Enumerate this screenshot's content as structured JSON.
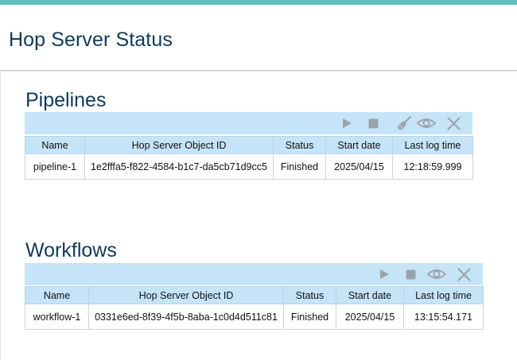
{
  "page": {
    "title": "Hop Server Status"
  },
  "pipelines": {
    "title": "Pipelines",
    "toolbar": [
      "play-icon",
      "stop-icon",
      "clean-icon",
      "eye-icon",
      "close-icon"
    ],
    "columns": [
      "Name",
      "Hop Server Object ID",
      "Status",
      "Start date",
      "Last log time"
    ],
    "rows": [
      [
        "pipeline-1",
        "1e2fffa5-f822-4584-b1c7-da5cb71d9cc5",
        "Finished",
        "2025/04/15",
        "12:18:59.999"
      ]
    ]
  },
  "workflows": {
    "title": "Workflows",
    "toolbar": [
      "play-icon",
      "stop-icon",
      "eye-icon",
      "close-icon"
    ],
    "columns": [
      "Name",
      "Hop Server Object ID",
      "Status",
      "Start date",
      "Last log time"
    ],
    "rows": [
      [
        "workflow-1",
        "0331e6ed-8f39-4f5b-8aba-1c0d4d511c81",
        "Finished",
        "2025/04/15",
        "13:15:54.171"
      ]
    ]
  },
  "colors": {
    "accent": "#5fc2c2",
    "title": "#0e3a5b",
    "toolbar_bg": "#c5e4f8",
    "icon": "#9aa3ab"
  }
}
